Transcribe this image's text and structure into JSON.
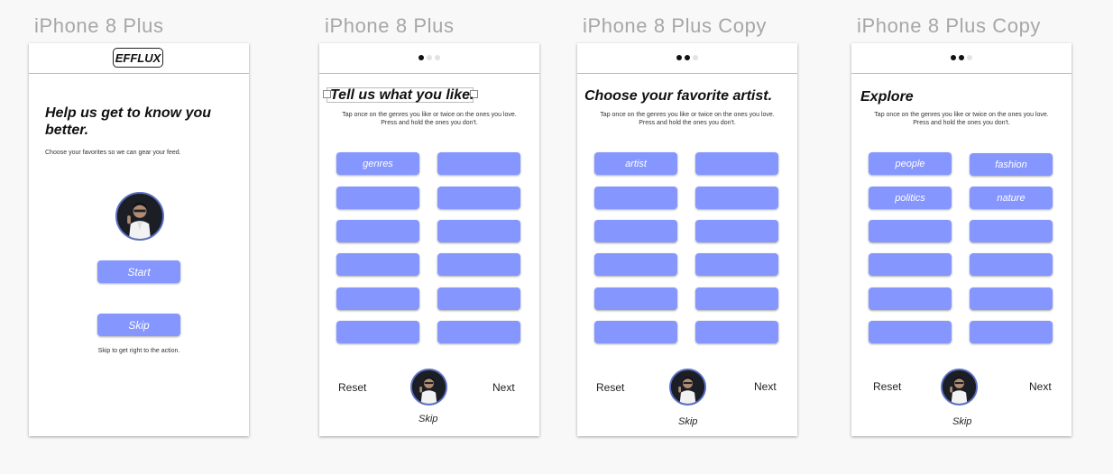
{
  "artboards": [
    {
      "title": "iPhone 8 Plus",
      "logo": "EFFLUX",
      "headline": "Help us get to know you better.",
      "subtext": "Choose your favorites so we can gear your feed.",
      "start_label": "Start",
      "skip_label": "Skip",
      "skip_caption": "Skip to get right to the action."
    },
    {
      "title": "iPhone 8 Plus",
      "page_indicator": {
        "total": 3,
        "active": 1
      },
      "headline": "Tell us what you like.",
      "subtext_line1": "Tap once on the genres you like or twice on the ones you love.",
      "subtext_line2": "Press and hold the ones you don't.",
      "options": [
        "genres",
        "",
        "",
        "",
        "",
        "",
        "",
        "",
        "",
        "",
        "",
        ""
      ],
      "reset_label": "Reset",
      "next_label": "Next",
      "skip_label": "Skip"
    },
    {
      "title": "iPhone 8 Plus Copy",
      "page_indicator": {
        "total": 3,
        "active": 2
      },
      "headline": "Choose your favorite artist.",
      "subtext_line1": "Tap once on the genres you like or twice on the ones you love.",
      "subtext_line2": "Press and hold the ones you don't.",
      "options": [
        "artist",
        "",
        "",
        "",
        "",
        "",
        "",
        "",
        "",
        "",
        "",
        ""
      ],
      "reset_label": "Reset",
      "next_label": "Next",
      "skip_label": "Skip"
    },
    {
      "title": "iPhone 8 Plus Copy",
      "page_indicator": {
        "total": 3,
        "active": 2
      },
      "headline": "Explore",
      "subtext_line1": "Tap once on the genres you like or twice on the ones you love.",
      "subtext_line2": "Press and hold the ones you don't.",
      "options": [
        "people",
        "fashion",
        "politics",
        "nature",
        "",
        "",
        "",
        "",
        "",
        "",
        "",
        ""
      ],
      "reset_label": "Reset",
      "next_label": "Next",
      "skip_label": "Skip"
    }
  ],
  "colors": {
    "pill": "#8596ff",
    "avatar_ring": "#5c6fc2",
    "artboard_title": "#a7a7a7"
  },
  "icons": {
    "avatar": "profile-photo"
  }
}
